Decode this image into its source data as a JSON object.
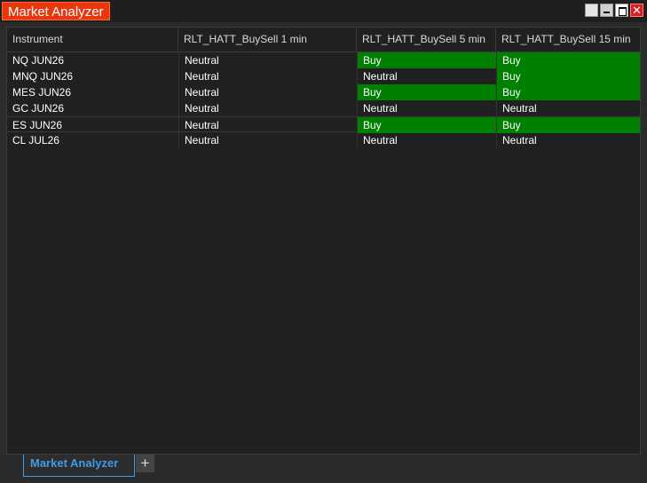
{
  "window": {
    "title": "Market Analyzer",
    "controls": {
      "close_glyph": "✕"
    }
  },
  "grid": {
    "columns": [
      "Instrument",
      "RLT_HATT_BuySell 1 min",
      "RLT_HATT_BuySell 5 min",
      "RLT_HATT_BuySell 15 min"
    ],
    "rows": [
      {
        "instrument": "NQ JUN26",
        "m1": "Neutral",
        "m5": "Buy",
        "m15": "Buy"
      },
      {
        "instrument": "MNQ JUN26",
        "m1": "Neutral",
        "m5": "Neutral",
        "m15": "Buy"
      },
      {
        "instrument": "MES JUN26",
        "m1": "Neutral",
        "m5": "Buy",
        "m15": "Buy"
      },
      {
        "instrument": "GC JUN26",
        "m1": "Neutral",
        "m5": "Neutral",
        "m15": "Neutral"
      },
      {
        "instrument": "ES JUN26",
        "m1": "Neutral",
        "m5": "Buy",
        "m15": "Buy"
      },
      {
        "instrument": "CL JUL26",
        "m1": "Neutral",
        "m5": "Neutral",
        "m15": "Neutral"
      }
    ],
    "colors": {
      "buy": "#008000",
      "neutral": "#202020"
    }
  },
  "tabs": {
    "items": [
      {
        "label": "Market Analyzer"
      }
    ],
    "add_label": "+"
  }
}
